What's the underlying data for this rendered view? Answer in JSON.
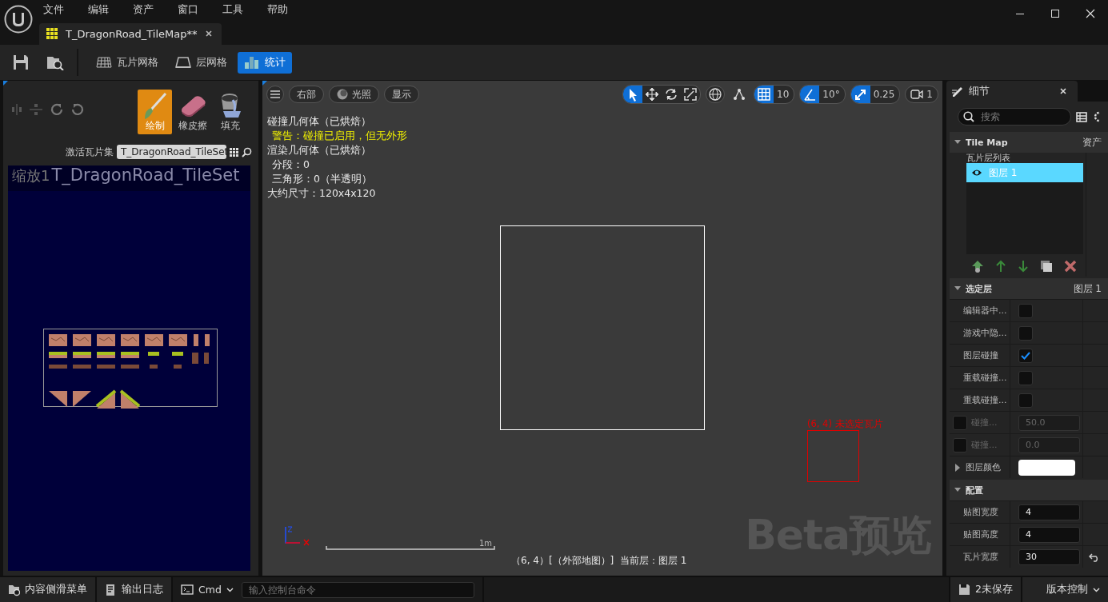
{
  "menu": [
    "文件",
    "编辑",
    "资产",
    "窗口",
    "工具",
    "帮助"
  ],
  "document_tab": {
    "title": "T_DragonRoad_TileMap**"
  },
  "toolbar": {
    "modes": [
      {
        "kind": "tile_grid",
        "label": "瓦片网格",
        "selected": false
      },
      {
        "kind": "layer_grid",
        "label": "层网格",
        "selected": false
      },
      {
        "kind": "stats",
        "label": "统计",
        "selected": true
      }
    ]
  },
  "tile_palette": {
    "tools": [
      {
        "kind": "paint",
        "label": "绘制",
        "selected": true
      },
      {
        "kind": "eraser",
        "label": "橡皮擦",
        "selected": false
      },
      {
        "kind": "fill",
        "label": "填充",
        "selected": false
      }
    ],
    "active_tileset_label": "激活瓦片集",
    "active_tileset": "T_DragonRoad_TileSet",
    "zoom_label": "缩放1",
    "tileset_title": "T_DragonRoad_TileSet"
  },
  "viewport": {
    "view_buttons": [
      {
        "kind": "menu"
      },
      {
        "kind": "text",
        "label": "右部"
      },
      {
        "kind": "lit",
        "label": "光照"
      },
      {
        "kind": "text",
        "label": "显示"
      }
    ],
    "transform_tools": [
      {
        "kind": "select",
        "selected": true
      },
      {
        "kind": "move",
        "selected": false
      },
      {
        "kind": "rotate",
        "selected": false
      },
      {
        "kind": "scale",
        "selected": false
      }
    ],
    "snaps": [
      {
        "kind": "grid",
        "value": "10",
        "on": true
      },
      {
        "kind": "angle",
        "value": "10°",
        "on": true
      },
      {
        "kind": "scale",
        "value": "0.25",
        "on": true
      }
    ],
    "camera_speed": "1",
    "stats": [
      {
        "kind": "heading",
        "text": "碰撞几何体（已烘焙）"
      },
      {
        "kind": "warning",
        "text": "警告：碰撞已启用，但无外形"
      },
      {
        "kind": "heading",
        "text": "渲染几何体（已烘焙）"
      },
      {
        "kind": "detail",
        "text": "分段：0"
      },
      {
        "kind": "detail",
        "text": "三角形：0（半透明）"
      },
      {
        "kind": "heading",
        "text": "大约尺寸：120x4x120"
      }
    ],
    "cursor_label": "(6, 4) 未选定瓦片",
    "scale_label": "1m",
    "status": "（6, 4）[（外部地图）]  当前层：图层 1",
    "preview_badge": "Beta预览"
  },
  "details": {
    "title": "细节",
    "search_placeholder": "搜索",
    "sections": [
      {
        "title": "Tile Map",
        "value": "资产",
        "expanded": true,
        "list_label": "瓦片层列表",
        "layers": [
          {
            "name": "图层 1",
            "selected": true
          }
        ]
      },
      {
        "title": "选定层",
        "value": "图层 1",
        "expanded": true,
        "properties": [
          {
            "kind": "checkbox",
            "label": "编辑器中...",
            "checked": false
          },
          {
            "kind": "checkbox",
            "label": "游戏中隐...",
            "checked": false
          },
          {
            "kind": "checkbox",
            "label": "图层碰撞",
            "checked": true
          },
          {
            "kind": "checkbox",
            "label": "重载碰撞...",
            "checked": false
          },
          {
            "kind": "checkbox",
            "label": "重载碰撞...",
            "checked": false
          },
          {
            "kind": "override",
            "label": "碰撞...",
            "checked": false,
            "value": "50.0"
          },
          {
            "kind": "override",
            "label": "碰撞...",
            "checked": false,
            "value": "0.0"
          },
          {
            "kind": "color",
            "label": "图层颜色",
            "expanded": false,
            "color": "#ffffff"
          }
        ]
      },
      {
        "title": "配置",
        "expanded": true,
        "properties": [
          {
            "kind": "number",
            "label": "贴图宽度",
            "value": "4"
          },
          {
            "kind": "number",
            "label": "贴图高度",
            "value": "4"
          },
          {
            "kind": "number",
            "label": "瓦片宽度",
            "value": "30",
            "modified": true
          }
        ]
      }
    ]
  },
  "status_bar": {
    "buttons": [
      {
        "kind": "content",
        "label": "内容侧滑菜单"
      },
      {
        "kind": "log",
        "label": "输出日志"
      }
    ],
    "cmd": "Cmd",
    "console_placeholder": "输入控制台命令",
    "unsaved": "2未保存",
    "source_control": "版本控制"
  }
}
